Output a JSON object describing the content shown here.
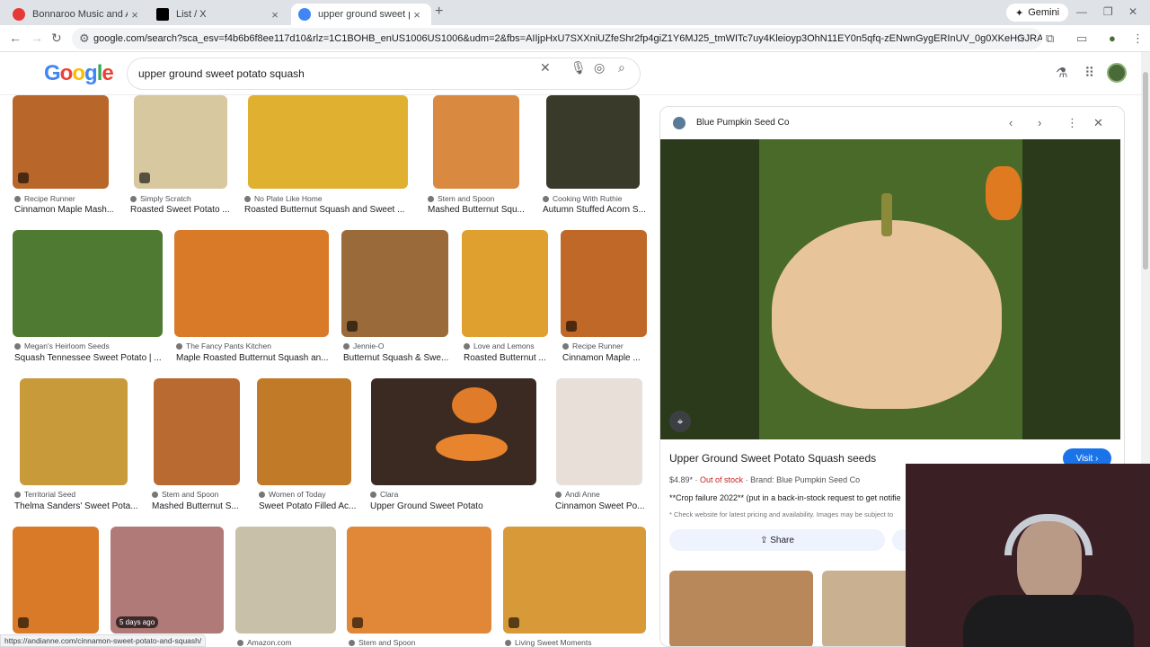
{
  "browser": {
    "tabs": [
      {
        "title": "Bonnaroo Music and Arts Festiv",
        "favicon_color": "#e53935"
      },
      {
        "title": "List / X",
        "favicon_color": "#000000"
      },
      {
        "title": "upper ground sweet potato squ",
        "favicon_color": "#4285f4"
      }
    ],
    "gemini_label": "Gemini",
    "url": "google.com/search?sca_esv=f4b6b6f8ee117d10&rlz=1C1BOHB_enUS1006US1006&udm=2&fbs=AIIjpHxU7SXXniUZfeShr2fp4giZ1Y6MJ25_tmWITc7uy4Kleioyp3OhN11EY0n5qfq-zENwnGygERInUV_0g0XKeHGJRAdFPaX_SSIJt7xYUfpm-0MQqcpkZ2..."
  },
  "search": {
    "logo": [
      "G",
      "o",
      "o",
      "g",
      "l",
      "e"
    ],
    "query": "upper ground sweet potato squash"
  },
  "results": [
    {
      "source": "Recipe Runner",
      "title": "Cinnamon Maple Mash...",
      "color": "#b8662a",
      "video": true
    },
    {
      "source": "Simply Scratch",
      "title": "Roasted Sweet Potato ...",
      "color": "#d8c8a0",
      "video": true
    },
    {
      "source": "No Plate Like Home",
      "title": "Roasted Butternut Squash and Sweet ...",
      "color": "#e0b030",
      "video": false
    },
    {
      "source": "Stem and Spoon",
      "title": "Mashed Butternut Squ...",
      "color": "#d98a40",
      "video": false
    },
    {
      "source": "Cooking With Ruthie",
      "title": "Autumn Stuffed Acorn S...",
      "color": "#3a3a2a",
      "video": false
    },
    {
      "source": "Megan's Heirloom Seeds",
      "title": "Squash Tennessee Sweet Potato | ...",
      "color": "#4f7a32",
      "video": false
    },
    {
      "source": "The Fancy Pants Kitchen",
      "title": "Maple Roasted Butternut Squash an...",
      "color": "#d87a28",
      "video": false
    },
    {
      "source": "Jennie-O",
      "title": "Butternut Squash & Swe...",
      "color": "#9a6a3a",
      "video": true
    },
    {
      "source": "Love and Lemons",
      "title": "Roasted Butternut ...",
      "color": "#e0a030",
      "video": false
    },
    {
      "source": "Recipe Runner",
      "title": "Cinnamon Maple ...",
      "color": "#c06828",
      "video": true
    },
    {
      "source": "Territorial Seed",
      "title": "Thelma Sanders' Sweet Pota...",
      "color": "#c89a3a",
      "video": false
    },
    {
      "source": "Stem and Spoon",
      "title": "Mashed Butternut S...",
      "color": "#b86a30",
      "video": false
    },
    {
      "source": "Women of Today",
      "title": "Sweet Potato Filled Ac...",
      "color": "#c07a28",
      "video": false
    },
    {
      "source": "Clara",
      "title": "Upper Ground Sweet Potato",
      "color": "#3a2a22",
      "video": false
    },
    {
      "source": "Andi Anne",
      "title": "Cinnamon Sweet Po...",
      "color": "#e8e0d8",
      "video": false
    },
    {
      "source": "",
      "title": "",
      "color": "#d87a28",
      "video": true
    },
    {
      "source": "",
      "title": "",
      "color": "#b07a78",
      "badge": "5 days ago"
    },
    {
      "source": "Amazon.com",
      "title": "",
      "color": "#c8c0a8",
      "video": false
    },
    {
      "source": "Stem and Spoon",
      "title": "",
      "color": "#e08838",
      "video": true
    },
    {
      "source": "Living Sweet Moments",
      "title": "",
      "color": "#d89a38",
      "video": true
    }
  ],
  "panel": {
    "site": "Blue Pumpkin Seed Co",
    "title": "Upper Ground Sweet Potato Squash seeds",
    "visit_label": "Visit",
    "price": "$4.89*",
    "stock": "Out of stock",
    "brand": "Brand: Blue Pumpkin Seed Co",
    "note": "**Crop failure 2022** (put in a back-in-stock request to get notifie",
    "disclaimer": "* Check website for latest pricing and availability. Images may be subject to",
    "share_label": "Share"
  },
  "status_url": "https://andianne.com/cinnamon-sweet-potato-and-squash/"
}
